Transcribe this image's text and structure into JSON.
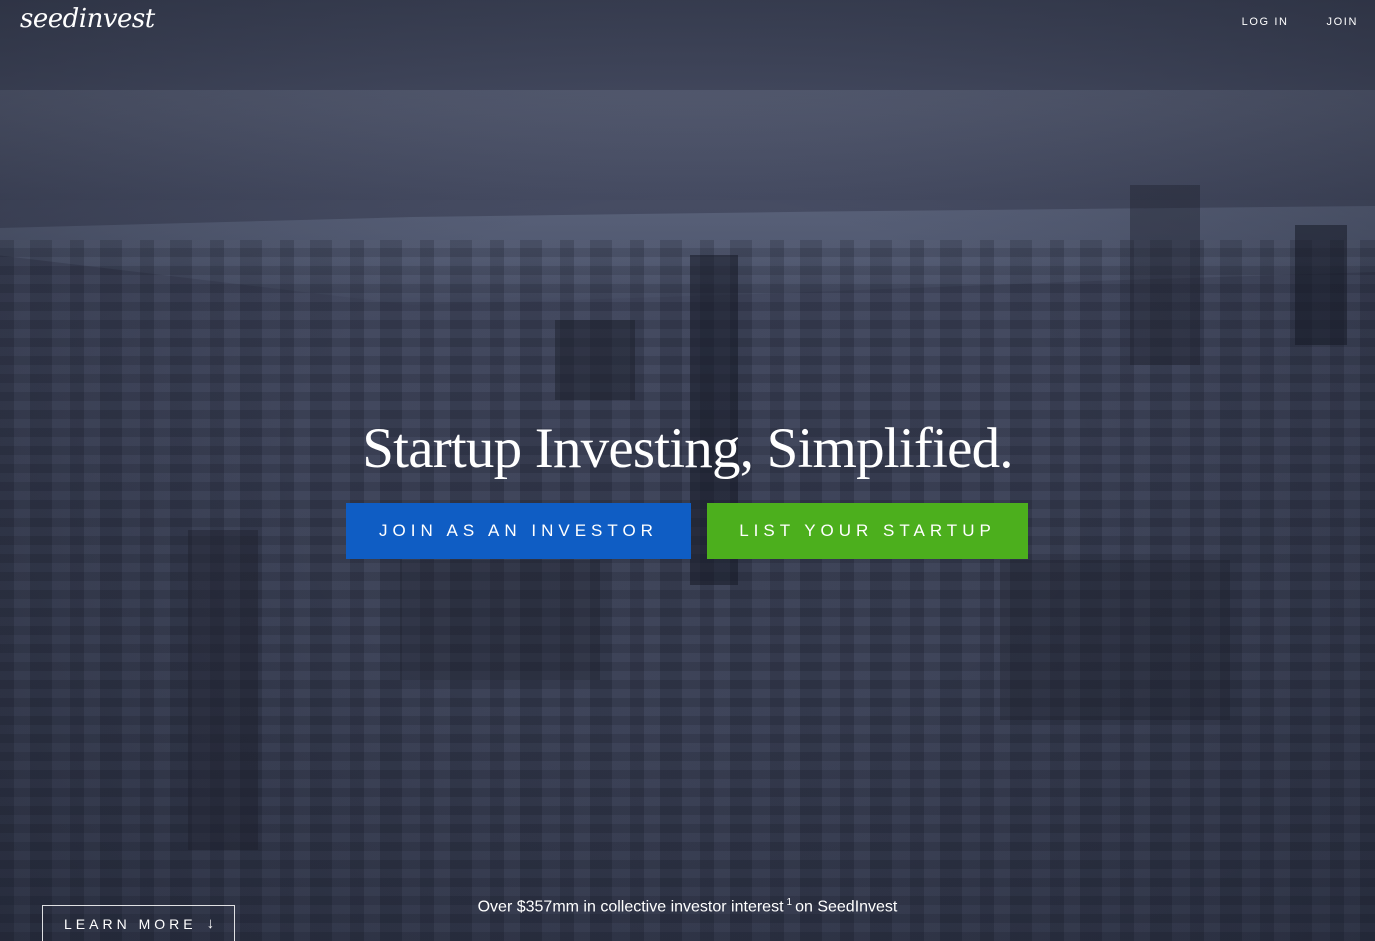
{
  "header": {
    "logo_text": "seedinvest",
    "nav": [
      {
        "label": "LOG IN"
      },
      {
        "label": "JOIN"
      }
    ]
  },
  "hero": {
    "headline": "Startup Investing, Simplified.",
    "cta_investor": "JOIN AS AN INVESTOR",
    "cta_startup": "LIST YOUR STARTUP",
    "learn_more": "LEARN MORE",
    "arrow_icon": "arrow-down-icon",
    "stat_prefix": "Over $357mm in collective investor interest",
    "stat_footnote": "1",
    "stat_suffix": "on SeedInvest"
  },
  "colors": {
    "investor_button": "#0f5dc4",
    "startup_button": "#4caf1d",
    "overlay": "#4a5068"
  }
}
